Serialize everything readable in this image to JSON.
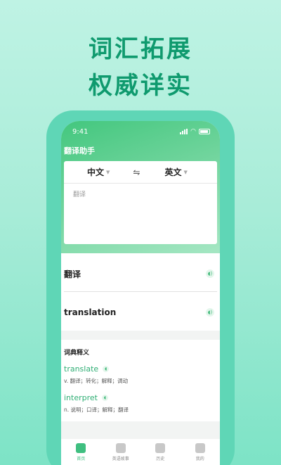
{
  "promo": {
    "line1": "词汇拓展",
    "line2": "权威详实"
  },
  "status_bar": {
    "time": "9:41"
  },
  "app": {
    "title": "翻译助手"
  },
  "translator": {
    "source_lang": "中文",
    "swap_symbol": "⇋",
    "target_lang": "英文",
    "input_value": "翻译"
  },
  "results": {
    "source_text": "翻译",
    "translated_text": "translation"
  },
  "dictionary": {
    "title": "词典释义",
    "entries": [
      {
        "word": "translate",
        "definition": "v. 翻译；转化；解释；调动"
      },
      {
        "word": "interpret",
        "definition": "n. 说明；口译；解释；翻译"
      }
    ]
  },
  "tabs": [
    {
      "label": "首页",
      "icon": "home-icon",
      "active": true
    },
    {
      "label": "英语故事",
      "icon": "book-icon",
      "active": false
    },
    {
      "label": "历史",
      "icon": "history-icon",
      "active": false
    },
    {
      "label": "我的",
      "icon": "user-icon",
      "active": false
    }
  ],
  "colors": {
    "brand_green": "#0f9a6e",
    "accent_green": "#3fbf80"
  }
}
